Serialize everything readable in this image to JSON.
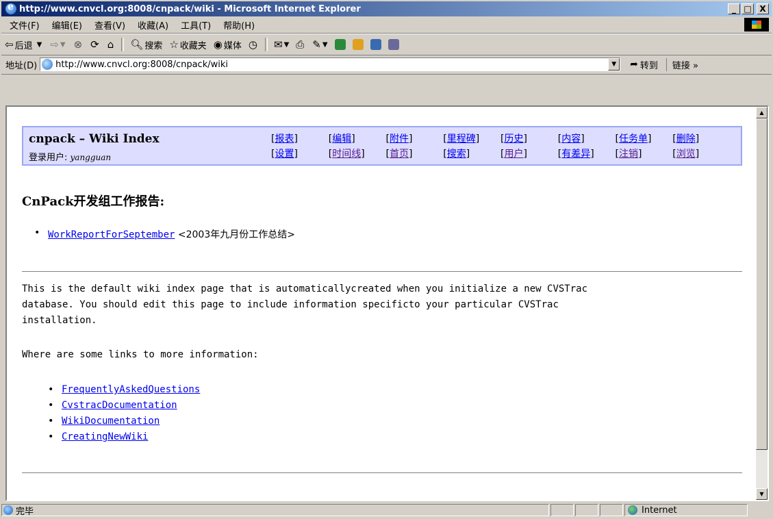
{
  "window": {
    "title": "http://www.cnvcl.org:8008/cnpack/wiki - Microsoft Internet Explorer",
    "min_glyph": "_",
    "max_glyph": "□",
    "close_glyph": "X"
  },
  "menubar": {
    "items": [
      "文件(F)",
      "编辑(E)",
      "查看(V)",
      "收藏(A)",
      "工具(T)",
      "帮助(H)"
    ]
  },
  "toolbar": {
    "back_label": "后退",
    "search_label": "搜索",
    "favorites_label": "收藏夹",
    "media_label": "媒体"
  },
  "address": {
    "label": "地址(D)",
    "url": "http://www.cnvcl.org:8008/cnpack/wiki",
    "go_label": "转到",
    "links_label": "链接 »"
  },
  "wiki": {
    "site_title": "cnpack  – Wiki Index",
    "login_prefix": "登录用户: ",
    "login_user": "yangguan",
    "nav_row1": [
      "报表",
      "编辑",
      "附件",
      "里程碑",
      "历史",
      "内容",
      "任务单",
      "删除"
    ],
    "nav_row2": [
      "设置",
      "时间线",
      "首页",
      "搜索",
      "用户",
      "有差异",
      "注销",
      "浏览"
    ],
    "heading": "CnPack开发组工作报告:",
    "report_link": "WorkReportForSeptember",
    "report_desc": " <2003年九月份工作总结>",
    "paragraph": "This is the default wiki index page that is automaticallycreated when you initialize a new CVSTrac\ndatabase. You should edit this page to include information specificto your particular CVSTrac\ninstallation.",
    "more_info": "Where are some links to more information:",
    "links": [
      "FrequentlyAskedQuestions",
      "CvstracDocumentation",
      "WikiDocumentation",
      "CreatingNewWiki"
    ]
  },
  "status": {
    "text": "完毕",
    "zone": "Internet"
  }
}
